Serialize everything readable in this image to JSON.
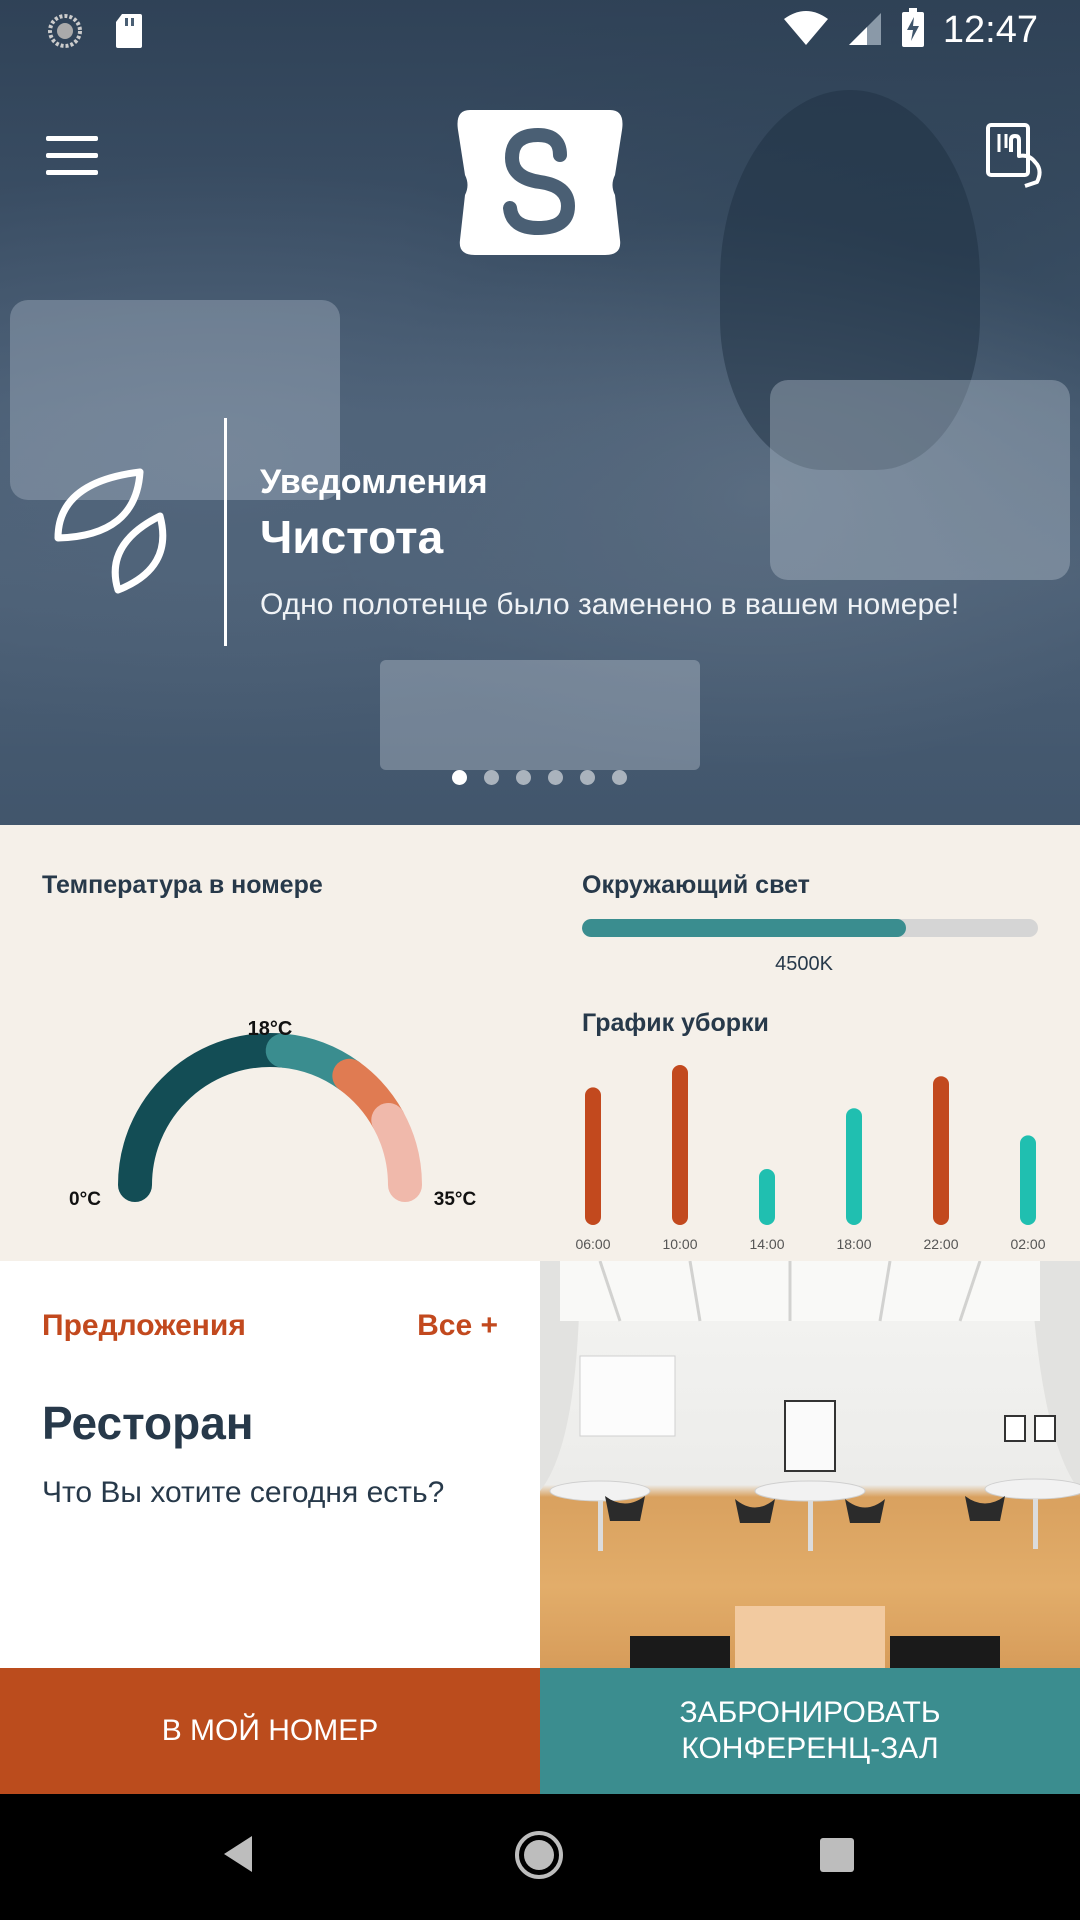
{
  "status_bar": {
    "time": "12:47"
  },
  "notification": {
    "label": "Уведомления",
    "title": "Чистота",
    "text": "Одно полотенце было заменено в вашем номере!"
  },
  "carousel": {
    "count": 6,
    "active": 0
  },
  "temperature": {
    "title": "Температура в номере",
    "value_label": "18°C",
    "min_label": "0°C",
    "max_label": "35°C",
    "value": 18,
    "min": 0,
    "max": 35
  },
  "ambient_light": {
    "title": "Окружающий свет",
    "value_label": "4500K",
    "fill_fraction": 0.71
  },
  "cleaning_chart": {
    "title": "График уборки",
    "chart_data": {
      "type": "bar",
      "categories": [
        "06:00",
        "10:00",
        "14:00",
        "18:00",
        "22:00",
        "02:00"
      ],
      "values": [
        0.86,
        1.0,
        0.35,
        0.73,
        0.93,
        0.56
      ],
      "colors": [
        "#c2491e",
        "#c2491e",
        "#20bfb0",
        "#20bfb0",
        "#c2491e",
        "#20bfb0"
      ]
    }
  },
  "offers": {
    "label": "Предложения",
    "all_link": "Все +",
    "title": "Ресторан",
    "subtitle": "Что Вы хотите сегодня есть?"
  },
  "buttons": {
    "my_room": "В МОЙ НОМЕР",
    "book_conference": "ЗАБРОНИРОВАТЬ\nКОНФЕРЕНЦ-ЗАЛ"
  },
  "colors": {
    "accent_orange": "#bb4c1d",
    "accent_teal": "#3b8d8f",
    "bar_teal": "#20bfb0",
    "text_dark": "#27394a"
  },
  "icons": {
    "menu": "hamburger-icon",
    "key_card": "key-card-icon",
    "notification": "leaf-icon"
  }
}
